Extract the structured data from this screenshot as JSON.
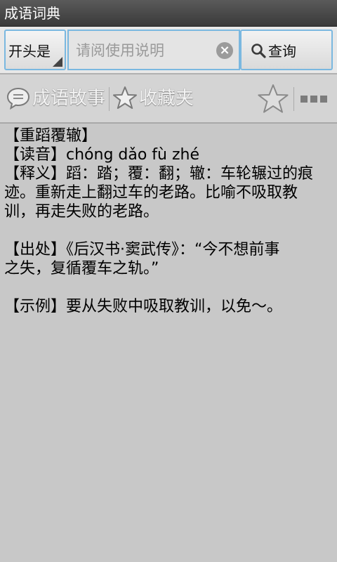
{
  "title_bar": {
    "title": "成语词典"
  },
  "search": {
    "mode_label": "开头是",
    "placeholder": "请阅使用说明",
    "value": "",
    "clear_symbol": "×",
    "query_label": "查询"
  },
  "toolbar": {
    "stories_label": "成语故事",
    "favorites_label": "收藏夹"
  },
  "entry": {
    "idiom": "【重蹈覆辙】",
    "pronunciation": "【读音】chóng dǎo fù zhé",
    "definition_1": "【释义】蹈：踏；覆：翻；辙：车轮辗过的痕",
    "definition_2": "迹。重新走上翻过车的老路。比喻不吸取教",
    "definition_3": "训，再走失败的老路。",
    "source_1": "【出处】《后汉书·窦武传》：“今不想前事",
    "source_2": "之失，复循覆车之轨。”",
    "example": "【示例】要从失败中吸取教训，以免～。"
  },
  "colors": {
    "title_bar": "#3a3a3a",
    "background": "#c8c8c8",
    "focus_border": "#7ab8e0"
  }
}
